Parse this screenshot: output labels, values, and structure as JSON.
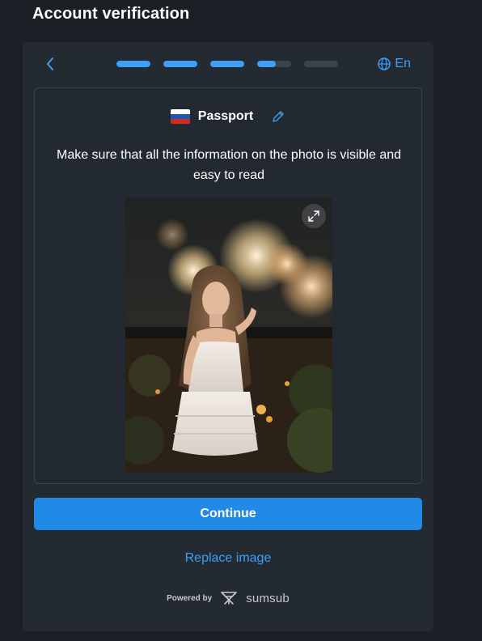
{
  "page": {
    "title": "Account verification"
  },
  "topbar": {
    "back_icon": "chevron-left-icon",
    "progress_steps": [
      1,
      1,
      1,
      0.55,
      0
    ],
    "language_icon": "globe-icon",
    "language_label": "En"
  },
  "document": {
    "flag_icon": "russia-flag-icon",
    "name": "Passport",
    "edit_icon": "pencil-icon"
  },
  "instructions": "Make sure that all the information on the photo is visible and easy to read",
  "photo": {
    "expand_icon": "expand-icon"
  },
  "actions": {
    "continue_label": "Continue",
    "replace_label": "Replace image"
  },
  "footer": {
    "powered_by": "Powered by",
    "brand": "sumsub"
  },
  "colors": {
    "background": "#1c1f25",
    "panel": "#242a32",
    "accent": "#2189e6",
    "link": "#3d9ff5"
  }
}
